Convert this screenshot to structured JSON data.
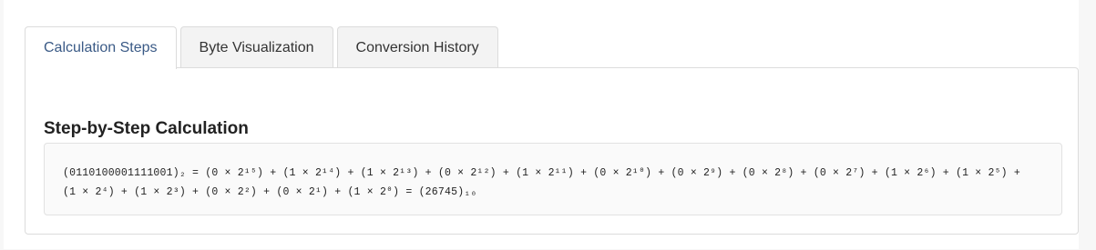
{
  "tabs": [
    {
      "label": "Calculation Steps",
      "active": true
    },
    {
      "label": "Byte Visualization",
      "active": false
    },
    {
      "label": "Conversion History",
      "active": false
    }
  ],
  "steps": {
    "heading": "Step-by-Step Calculation",
    "line1": "(0110100001111001)₂ = (0 × 2¹⁵) + (1 × 2¹⁴) + (1 × 2¹³) + (0 × 2¹²) + (1 × 2¹¹) + (0 × 2¹⁰) + (0 × 2⁹) + (0 × 2⁸) + (0 × 2⁷) + (1 × 2⁶) + (1 × 2⁵) +",
    "line2": "(1 × 2⁴) + (1 × 2³) + (0 × 2²) + (0 × 2¹) + (1 × 2⁰) = (26745)₁₀"
  },
  "colors": {
    "active_tab_text": "#3a5a86",
    "border": "#dcdcdc"
  }
}
